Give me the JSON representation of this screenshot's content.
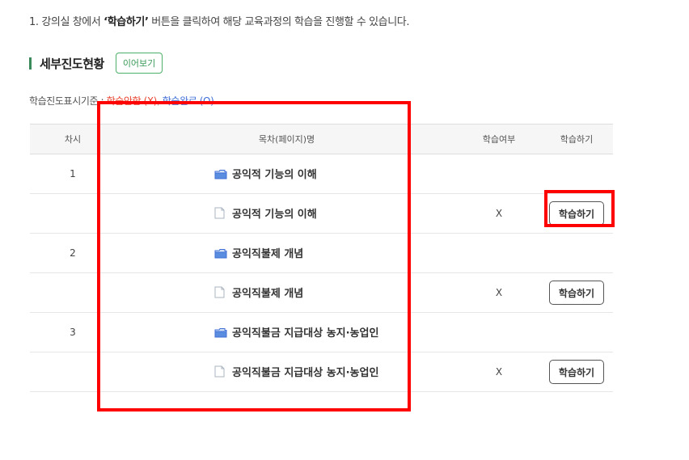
{
  "instruction": {
    "prefix": "1. 강의실 창에서 ",
    "emphasis": "‘학습하기’",
    "suffix": " 버튼을 클릭하여 해당 교육과정의 학습을 진행할 수 있습니다."
  },
  "section": {
    "title": "세부진도현황",
    "resume_button": "이어보기"
  },
  "legend": {
    "label": "학습진도표시기준 : ",
    "incomplete": "학습안함 (X)",
    "separator": ", ",
    "complete": "학습완료 (O)"
  },
  "table": {
    "headers": {
      "no": "차시",
      "title": "목차(페이지)명",
      "status": "학습여부",
      "action": "학습하기"
    },
    "rows": [
      {
        "no": "1",
        "title": "공익적 기능의 이해",
        "icon": "folder-icon",
        "status": "",
        "action": ""
      },
      {
        "no": "",
        "title": "공익적 기능의 이해",
        "icon": "page-icon",
        "status": "X",
        "action": "학습하기"
      },
      {
        "no": "2",
        "title": "공익직불제 개념",
        "icon": "folder-icon",
        "status": "",
        "action": ""
      },
      {
        "no": "",
        "title": "공익직불제 개념",
        "icon": "page-icon",
        "status": "X",
        "action": "학습하기"
      },
      {
        "no": "3",
        "title": "공익직불금 지급대상 농지·농업인",
        "icon": "folder-icon",
        "status": "",
        "action": ""
      },
      {
        "no": "",
        "title": "공익직불금 지급대상 농지·농업인",
        "icon": "page-icon",
        "status": "X",
        "action": "학습하기"
      }
    ]
  },
  "colors": {
    "accent_green": "#3a8a5c",
    "incomplete_red": "#e8452f",
    "complete_blue": "#3f6ed6",
    "highlight_red": "#ff0000"
  }
}
